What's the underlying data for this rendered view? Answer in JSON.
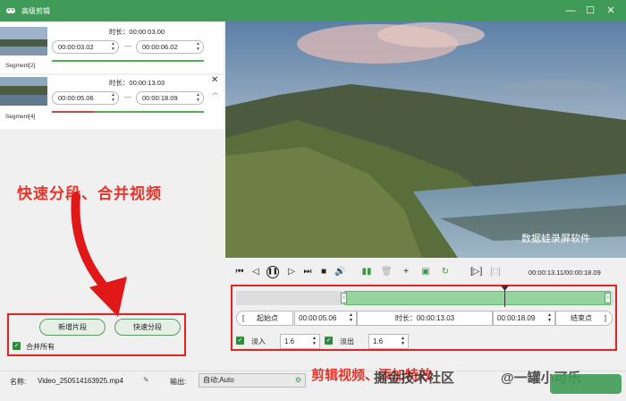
{
  "window": {
    "title": "高级剪辑"
  },
  "segments": [
    {
      "label": "Segment[2]",
      "duration": "时长：00:00:03.00",
      "start": "00:00:03.02",
      "end": "00:00:06.02"
    },
    {
      "label": "Segment[4]",
      "duration": "时长：00:00:13.03",
      "start": "00:00:05.06",
      "end": "00:00:18.09"
    }
  ],
  "annotations": {
    "left_caption": "快速分段、合并视频",
    "bottom_caption": "剪辑视频、添加特效",
    "video_watermark": "数据蛙录屏软件",
    "site_watermark": "掘金技术社区",
    "author_watermark": "@一罐小可乐"
  },
  "left_actions": {
    "add_segment": "新增片段",
    "quick_split": "快速分段",
    "merge_all": "合并所有"
  },
  "player": {
    "time": "00:00:13.11/00:00:18.09"
  },
  "trim": {
    "start_btn": "起始点",
    "start_value": "00:00:05.06",
    "duration": "时长：00:00:13.03",
    "end_value": "00:00:18.09",
    "end_btn": "结束点",
    "fade_in_label": "淡入",
    "fade_in_value": "1.6",
    "fade_out_label": "淡出",
    "fade_out_value": "1.6"
  },
  "footer": {
    "name_label": "名称:",
    "name_value": "Video_250514163925.mp4",
    "output_label": "输出:",
    "output_value": "自动;Auto"
  }
}
